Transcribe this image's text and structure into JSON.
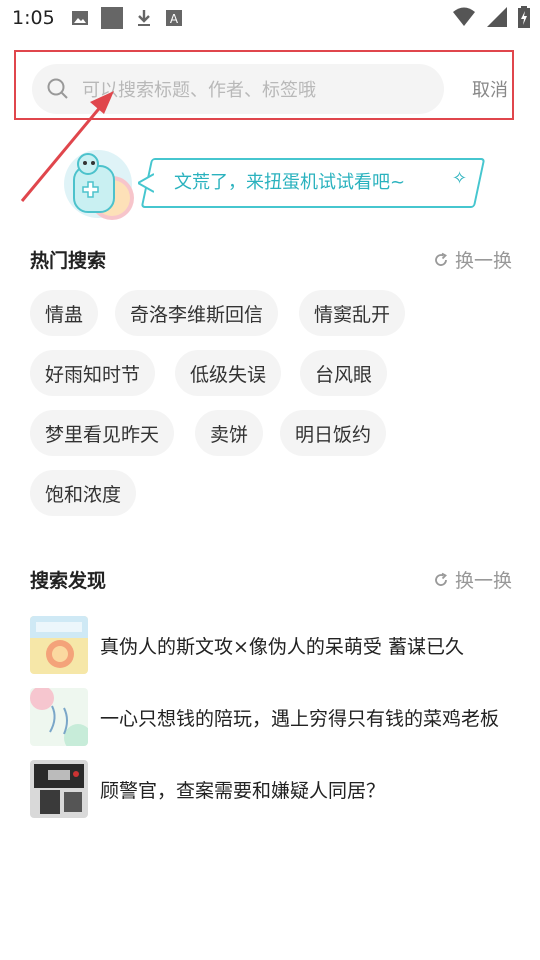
{
  "status_bar": {
    "time": "1:05",
    "icons": [
      "image-icon",
      "square-icon",
      "download-icon",
      "text-badge-icon"
    ],
    "right_icons": [
      "wifi-icon",
      "signal-icon",
      "battery-icon"
    ]
  },
  "search": {
    "placeholder": "可以搜索标题、作者、标签哦",
    "cancel_label": "取消",
    "highlight_color": "#e0464c"
  },
  "banner": {
    "text": "文荒了，来扭蛋机试试看吧~",
    "sparkle": "✧",
    "accent": "#2ab2be"
  },
  "hot_search": {
    "title": "热门搜索",
    "refresh_label": "换一换",
    "tags": [
      "情蛊",
      "奇洛李维斯回信",
      "情窦乱开",
      "好雨知时节",
      "低级失误",
      "台风眼",
      "梦里看见昨天",
      "卖饼",
      "明日饭约",
      "饱和浓度"
    ]
  },
  "discover": {
    "title": "搜索发现",
    "refresh_label": "换一换",
    "items": [
      {
        "title": "真伪人的斯文攻×像伪人的呆萌受 蓄谋已久",
        "cover": "cover-1"
      },
      {
        "title": "一心只想钱的陪玩，遇上穷得只有钱的菜鸡老板",
        "cover": "cover-2"
      },
      {
        "title": "顾警官，查案需要和嫌疑人同居？",
        "cover": "cover-3"
      }
    ]
  }
}
